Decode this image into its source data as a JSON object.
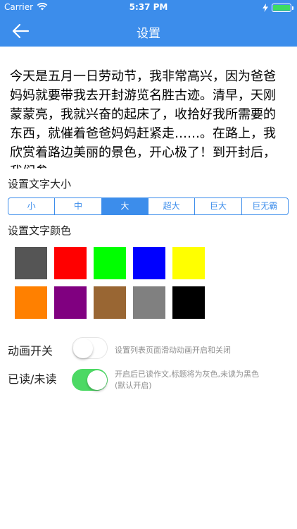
{
  "status_bar": {
    "carrier": "Carrier",
    "time": "5:37 PM",
    "battery_color": "#3DDC60"
  },
  "nav": {
    "title": "设置",
    "back_icon": "back-arrow-icon",
    "background": "#3C8DEB"
  },
  "sample_text": "今天是五月一日劳动节，我非常高兴，因为爸爸妈妈就要带我去开封游览名胜古迹。清早，天刚蒙蒙亮，我就兴奋的起床了，收拾好我所需要的东西，就催着爸爸妈妈赶紧走……。在路上，我欣赏着路边美丽的景色，开心极了！到开封后，我们参",
  "font_size": {
    "label": "设置文字大小",
    "options": [
      "小",
      "中",
      "大",
      "超大",
      "巨大",
      "巨无霸"
    ],
    "selected": "大"
  },
  "font_color": {
    "label": "设置文字颜色",
    "swatches": [
      "#555555",
      "#FF0000",
      "#00FF00",
      "#0000FF",
      "#FFFF00",
      "#FF8000",
      "#800080",
      "#996633",
      "#808080",
      "#000000"
    ]
  },
  "animation": {
    "label": "动画开关",
    "on": false,
    "description": "设置列表页面滑动动画开启和关闭"
  },
  "read_status": {
    "label": "已读/未读",
    "on": true,
    "description_line1": "开启后已读作文,标题将为灰色,未读为黑色",
    "description_line2": "(默认开启)"
  }
}
